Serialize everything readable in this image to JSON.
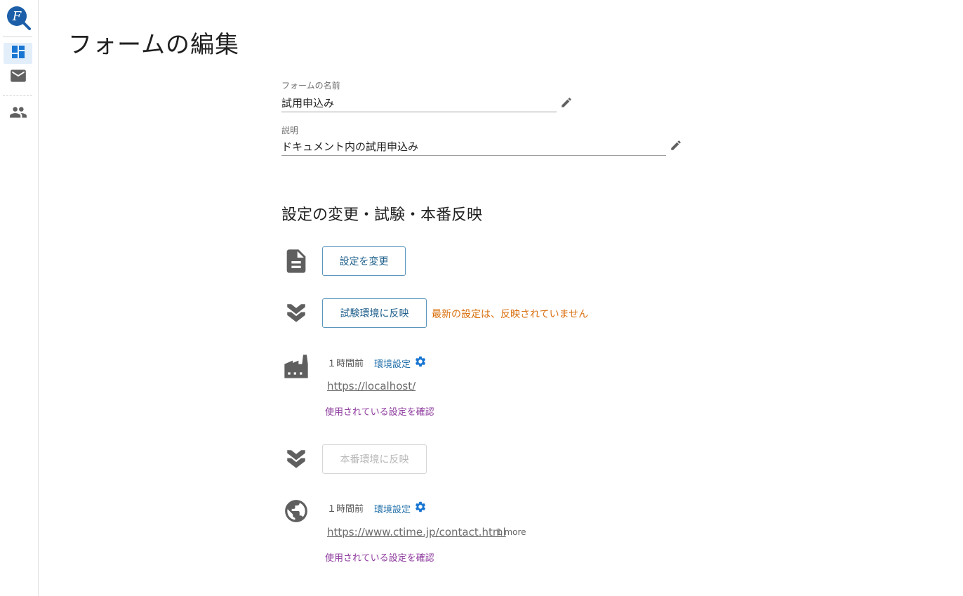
{
  "page": {
    "title": "フォームの編集"
  },
  "sidebar": {
    "logo_letter": "F",
    "items": [
      {
        "name": "dashboard",
        "icon": "dashboard-icon",
        "active": true
      },
      {
        "name": "mail",
        "icon": "mail-icon",
        "active": false
      },
      {
        "name": "users",
        "icon": "people-icon",
        "active": false
      }
    ]
  },
  "form": {
    "name_label": "フォームの名前",
    "name_value": "試用申込み",
    "description_label": "説明",
    "description_value": "ドキュメント内の試用申込み"
  },
  "deploy": {
    "heading": "設定の変更・試験・本番反映",
    "change_button": "設定を変更",
    "test_button": "試験環境に反映",
    "test_warning": "最新の設定は、反映されていません",
    "test_env": {
      "time": "１時間前",
      "env_settings_label": "環境設定",
      "url": "https://localhost/",
      "check_link": "使用されている設定を確認"
    },
    "prod_button": "本番環境に反映",
    "prod_env": {
      "time": "１時間前",
      "env_settings_label": "環境設定",
      "url": "https://www.ctime.jp/contact.html",
      "more": "1 more",
      "check_link": "使用されている設定を確認"
    }
  },
  "colors": {
    "accent": "#1f6ea8",
    "warning": "#d9700f",
    "visited_link": "#8e3b9e",
    "icon_gray": "#5f5f5f"
  }
}
